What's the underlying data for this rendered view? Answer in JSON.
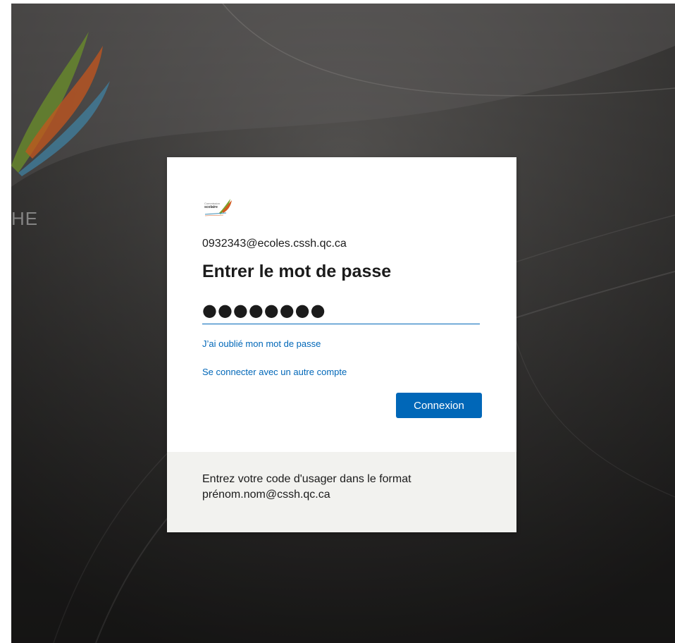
{
  "background": {
    "partial_text": "HE"
  },
  "card": {
    "logo": {
      "line1": "Commission",
      "line2": "scolaire"
    },
    "email": "0932343@ecoles.cssh.qc.ca",
    "title": "Entrer le mot de passe",
    "password_mask": "●●●●●●●●",
    "forgot_link": "J’ai oublié mon mot de passe",
    "other_account_link": "Se connecter avec un autre compte",
    "submit_label": "Connexion",
    "footer_text": "Entrez votre code d'usager dans le format prénom.nom@cssh.qc.ca"
  },
  "colors": {
    "accent": "#0067b8",
    "background_dark": "#4a4846",
    "footer_bg": "#f2f2ef"
  }
}
